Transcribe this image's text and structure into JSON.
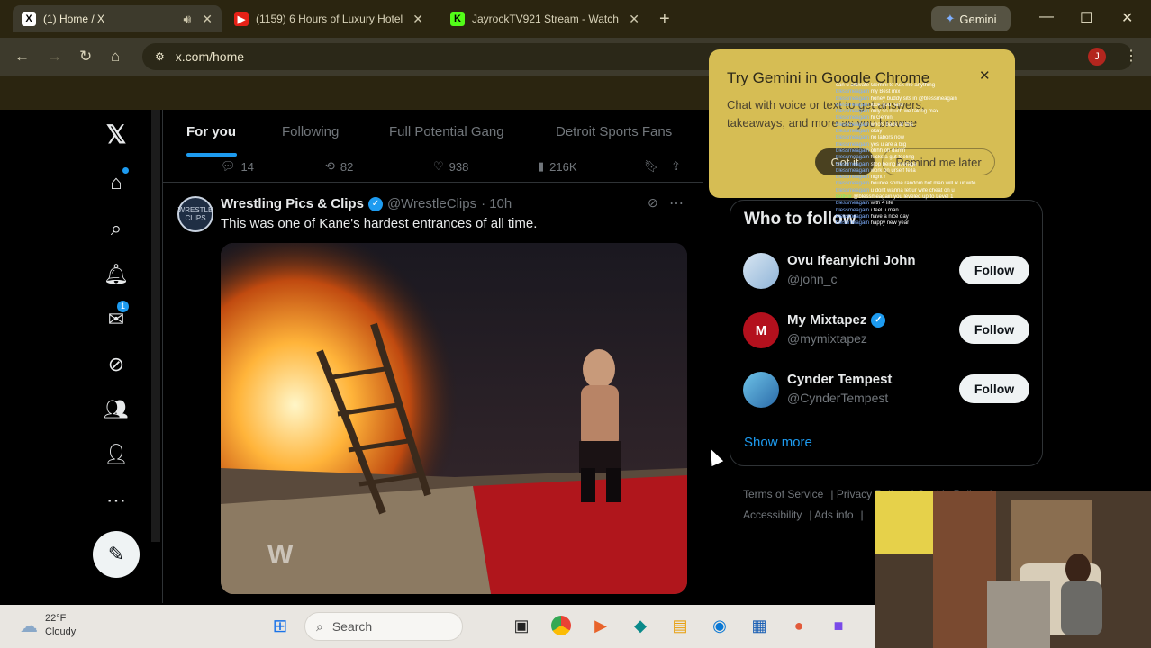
{
  "browser": {
    "tabs": [
      {
        "title": "(1) Home / X",
        "favicon": "x-logo",
        "active": true
      },
      {
        "title": "(1159) 6 Hours of Luxury Hotel",
        "favicon": "youtube-logo",
        "active": false
      },
      {
        "title": "JayrockTV921 Stream - Watch",
        "favicon": "kick-logo",
        "active": false
      }
    ],
    "gemini_chip": "Gemini",
    "url": "x.com/home",
    "profile_initial": "J"
  },
  "feed_tabs": [
    "For you",
    "Following",
    "Full Potential Gang",
    "Detroit Sports Fans"
  ],
  "prev_tweet_actions": {
    "replies": "14",
    "reposts": "82",
    "likes": "938",
    "views": "216K"
  },
  "tweet": {
    "avatar_text": "WRESTLE CLIPS",
    "name": "Wrestling Pics & Clips",
    "handle": "@WrestleClips",
    "time": "· 10h",
    "text": "This was one of Kane's hardest entrances of all time.",
    "watermark": "W"
  },
  "nav": {
    "messages_badge": "1",
    "icons": [
      "x-logo",
      "home-icon",
      "search-icon",
      "bell-icon",
      "mail-icon",
      "grok-icon",
      "communities-icon",
      "profile-icon",
      "more-icon",
      "post-icon"
    ]
  },
  "who_to_follow": {
    "title": "Who to follow",
    "items": [
      {
        "name": "Ovu Ifeanyichi John",
        "handle": "@john_c",
        "button": "Follow",
        "verified": false
      },
      {
        "name": "My Mixtapez",
        "handle": "@mymixtapez",
        "button": "Follow",
        "verified": true
      },
      {
        "name": "Cynder Tempest",
        "handle": "@CynderTempest",
        "button": "Follow",
        "verified": false
      }
    ],
    "show_more": "Show more"
  },
  "footer_links": [
    "Terms of Service",
    "Privacy Policy",
    "Cookie Policy",
    "Accessibility",
    "Ads info"
  ],
  "gemini_popup": {
    "title": "Try Gemini in Google Chrome",
    "body": "Chat with voice or text to get answers, takeaways, and more as you browse",
    "got_it": "Got it",
    "remind": "Remind me later"
  },
  "chat": [
    {
      "user": "",
      "msg": "can u activate Gemini to Ask me anything"
    },
    {
      "user": "blessmeagain",
      "msg": "my Best mix"
    },
    {
      "user": "blessmeagain",
      "msg": "honey buddy sits in @blessmeagain"
    },
    {
      "user": "blessmeagain",
      "msg": "look you hard"
    },
    {
      "user": "blessmeagain",
      "msg": "only so much we taking max"
    },
    {
      "user": "blessmeagain",
      "msg": "hi Gemini"
    },
    {
      "user": "blessmeagain",
      "msg": "who's back at this"
    },
    {
      "user": "blessmeagain",
      "msg": "okay"
    },
    {
      "user": "blessmeagain",
      "msg": "no labors now"
    },
    {
      "user": "blessmeagain",
      "msg": "yes u are a big"
    },
    {
      "user": "blessmeagain",
      "msg": "ohhh oh damn"
    },
    {
      "user": "blessmeagain",
      "msg": "fucks a gut feeling"
    },
    {
      "user": "blessmeagain",
      "msg": "stop being average"
    },
    {
      "user": "blessmeagain",
      "msg": "work on urself fella"
    },
    {
      "user": "blessmeagain",
      "msg": "night !"
    },
    {
      "user": "blessmeagain",
      "msg": "bounce some random hot man will ik ur wife"
    },
    {
      "user": "blessmeagain",
      "msg": "u dont wanna let ur wife cheat on u"
    },
    {
      "user": "BotRix",
      "msg": "@blessmeagain you leveled up to Level 1"
    },
    {
      "user": "blessmeagain",
      "msg": "with 4 life"
    },
    {
      "user": "blessmeagain",
      "msg": "i feel u man"
    },
    {
      "user": "blessmeagain",
      "msg": "have a nice day"
    },
    {
      "user": "blessmeagain",
      "msg": "happy new year"
    }
  ],
  "taskbar": {
    "temp": "22°F",
    "condition": "Cloudy",
    "search_placeholder": "Search"
  }
}
